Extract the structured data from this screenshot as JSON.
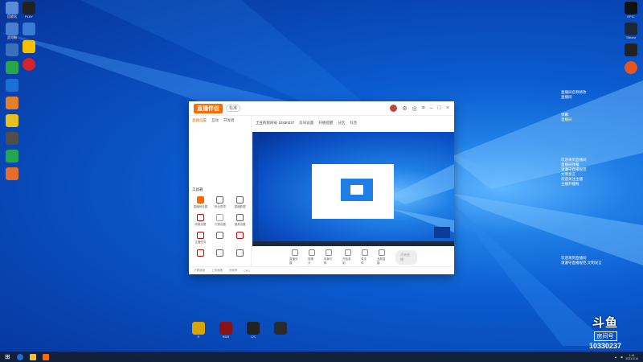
{
  "desktop": {
    "left_icons": [
      {
        "label": "回收站",
        "color": "#5b8bd8"
      },
      {
        "label": "此电脑",
        "color": "#4a7fcf"
      },
      {
        "label": "",
        "color": "#3a6fbe"
      },
      {
        "label": "",
        "color": "#2aa64a"
      },
      {
        "label": "",
        "color": "#1b6fd6"
      },
      {
        "label": "",
        "color": "#e0802a"
      },
      {
        "label": "",
        "color": "#e6c21e"
      },
      {
        "label": "",
        "color": "#4e4e4e"
      },
      {
        "label": "",
        "color": "#22a650"
      },
      {
        "label": "",
        "color": "#e36f2a"
      }
    ],
    "second_col_icons": [
      {
        "label": "PLAY",
        "color": "#222"
      },
      {
        "label": "",
        "color": "#3a7bd5"
      },
      {
        "label": "",
        "color": "#f5c000"
      },
      {
        "label": "",
        "color": "#d4232a"
      }
    ],
    "right_icons": [
      {
        "label": "EPIC",
        "color": "#111"
      },
      {
        "label": "Steam",
        "color": "#1b2838"
      },
      {
        "label": "",
        "color": "#222"
      },
      {
        "label": "",
        "color": "#e3561f"
      }
    ],
    "bottom_icons": [
      {
        "label": "R",
        "color": "#d9a400"
      },
      {
        "label": "RDR",
        "color": "#8a1212"
      },
      {
        "label": "CS",
        "color": "#222"
      },
      {
        "label": "",
        "color": "#2a2a2a"
      }
    ]
  },
  "app": {
    "logo": "直播伴侣",
    "version": "标准",
    "left_tabs": [
      "直播设置",
      "互动",
      "开发者"
    ],
    "tool_title": "工具箱",
    "tools": [
      "直播间设置",
      "粉丝勋章",
      "直播数据",
      "房管设置",
      "礼物设置",
      "道具设置",
      "主播任务",
      "",
      "",
      "",
      "",
      ""
    ],
    "room_title": "土豆的房间号 10330237",
    "room_id": "10330237",
    "room_meta": [
      "房间设置",
      "开播提醒",
      "分区",
      "标签"
    ],
    "bottom_tools": [
      "直播设置",
      "摄像头",
      "场景切换",
      "开始录制",
      "麦克风",
      "全屏直播"
    ],
    "start_button": "开始直播",
    "status": [
      "下载速度",
      "上传速度",
      "丢帧率",
      "CPU"
    ]
  },
  "right_panel": {
    "lines_top": [
      "直播间名称修改",
      "直播间",
      "弹幕:",
      "直播间"
    ],
    "lines_mid": [
      "欢迎来到直播间",
      "直播间弹幕",
      "请遵守直播规范",
      "文明发言",
      "欢迎关注主播",
      "主播开播啦"
    ],
    "lines_bottom": [
      "欢迎来到直播间",
      "请遵守直播规范,文明发言"
    ]
  },
  "watermark": {
    "logo": "斗鱼",
    "sub": "房间号",
    "room": "10330237"
  },
  "taskbar": {
    "time": "1:41",
    "date": "2021/1/10"
  }
}
